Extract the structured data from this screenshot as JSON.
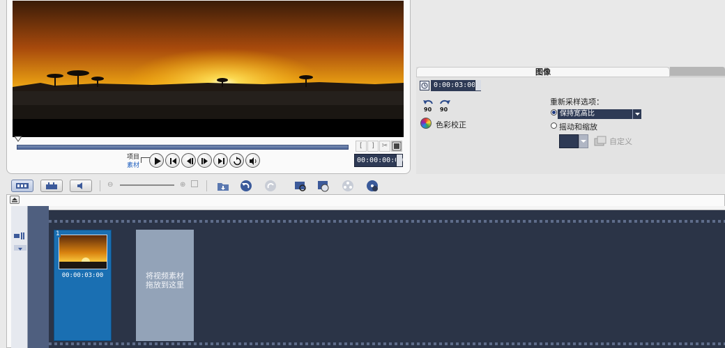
{
  "preview": {
    "mode_project": "项目",
    "mode_clip": "素材",
    "timecode": "00:00:00:00",
    "trim_in": "[",
    "trim_out": "]"
  },
  "options": {
    "tab_label": "图像",
    "duration": "0:00:03:00",
    "resample_title": "重新采样选项：",
    "resample_selected": "保持宽高比",
    "pan_zoom_label": "摇动和缩放",
    "customize_label": "自定义",
    "color_correction_label": "色彩校正"
  },
  "timeline": {
    "clip_index": "1",
    "clip_duration": "00:00:03:00",
    "drop_hint_line1": "将视频素材",
    "drop_hint_line2": "拖放到这里"
  },
  "colors": {
    "accent_dark": "#2e3a55",
    "clip_selected": "#1a6fb2",
    "storyboard_bg": "#2b3447"
  }
}
